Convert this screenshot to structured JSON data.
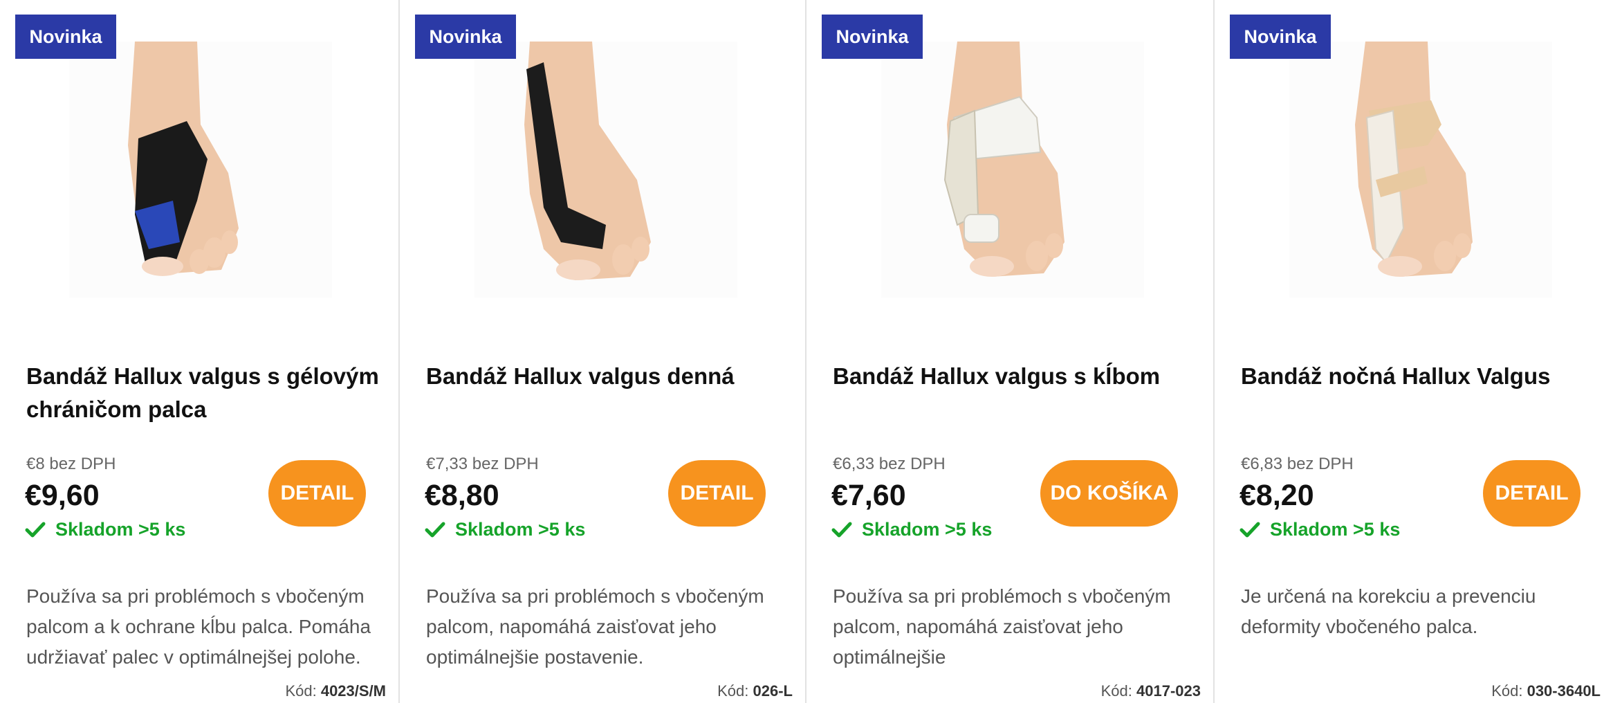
{
  "products": [
    {
      "badge": "Novinka",
      "title": "Bandáž Hallux valgus s gélovým chráničom palca",
      "price_net": "€8 bez DPH",
      "price": "€9,60",
      "stock": "Skladom >5 ks",
      "button": "DETAIL",
      "description": "Používa sa pri problémoch s vbočeným palcom a k ochrane kĺbu palca. Pomáha udržiavať palec v optimálnejšej polohe.",
      "code_label": "Kód:",
      "code": "4023/S/M",
      "strap_color": "#1a1a1a",
      "accent_color": "#2a48b8"
    },
    {
      "badge": "Novinka",
      "title": "Bandáž Hallux valgus denná",
      "price_net": "€7,33 bez DPH",
      "price": "€8,80",
      "stock": "Skladom >5 ks",
      "button": "DETAIL",
      "description": "Používa sa pri problémoch s vbočeným palcom, napomáhá zaisťovat jeho optimálnejšie postavenie.",
      "code_label": "Kód:",
      "code": "026-L",
      "strap_color": "#1c1c1c",
      "accent_color": "#1c1c1c"
    },
    {
      "badge": "Novinka",
      "title": "Bandáž Hallux valgus s kĺbom",
      "price_net": "€6,33 bez DPH",
      "price": "€7,60",
      "stock": "Skladom >5 ks",
      "button": "DO KOŠÍKA",
      "description": "Používa sa pri problémoch s vbočeným palcom, napomáhá zaisťovat jeho optimálnejšie",
      "code_label": "Kód:",
      "code": "4017-023",
      "strap_color": "#f4f4f0",
      "accent_color": "#e6e2d4"
    },
    {
      "badge": "Novinka",
      "title": "Bandáž nočná Hallux Valgus",
      "price_net": "€6,83 bez DPH",
      "price": "€8,20",
      "stock": "Skladom >5 ks",
      "button": "DETAIL",
      "description": "Je určená na korekciu a prevenciu deformity vbočeného palca.",
      "code_label": "Kód:",
      "code": "030-3640L",
      "strap_color": "#e8c9a0",
      "accent_color": "#f2ede4"
    }
  ],
  "colors": {
    "badge_bg": "#2b3aa6",
    "button_bg": "#f7931e",
    "stock_green": "#16a32a"
  },
  "icons": {
    "stock": "checkmark-icon"
  }
}
